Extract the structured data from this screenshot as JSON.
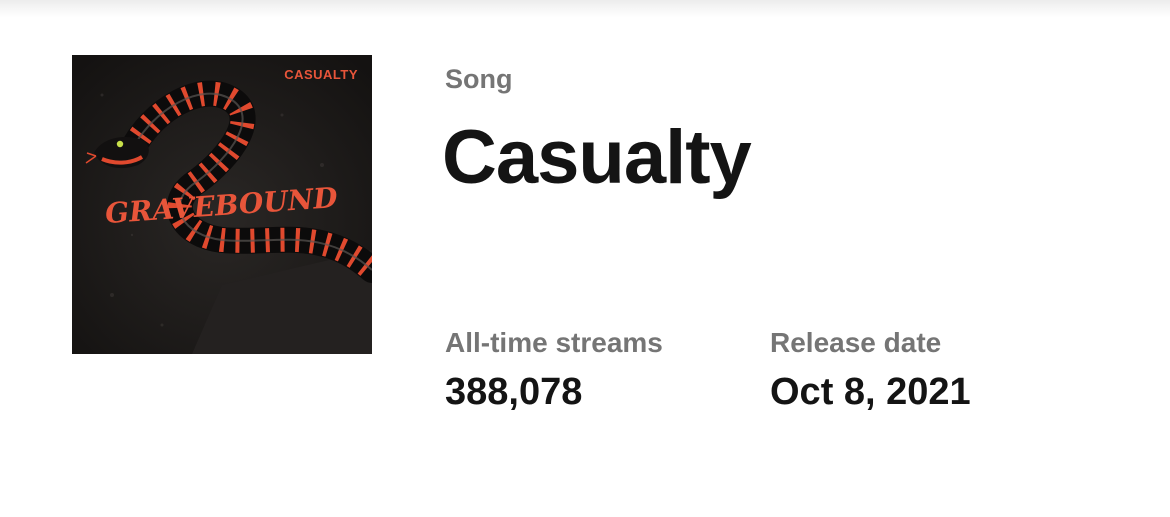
{
  "cover": {
    "band_name": "CASUALTY",
    "logo_text": "GRAVEBOUND",
    "colors": {
      "background": "#1d1b1a",
      "accent": "#e8553a"
    }
  },
  "song": {
    "type_label": "Song",
    "title": "Casualty"
  },
  "stats": {
    "streams": {
      "label": "All-time streams",
      "value": "388,078"
    },
    "release": {
      "label": "Release date",
      "value": "Oct 8, 2021"
    }
  },
  "colors": {
    "primary_text": "#141414",
    "secondary_text": "#757575",
    "background": "#ffffff"
  }
}
